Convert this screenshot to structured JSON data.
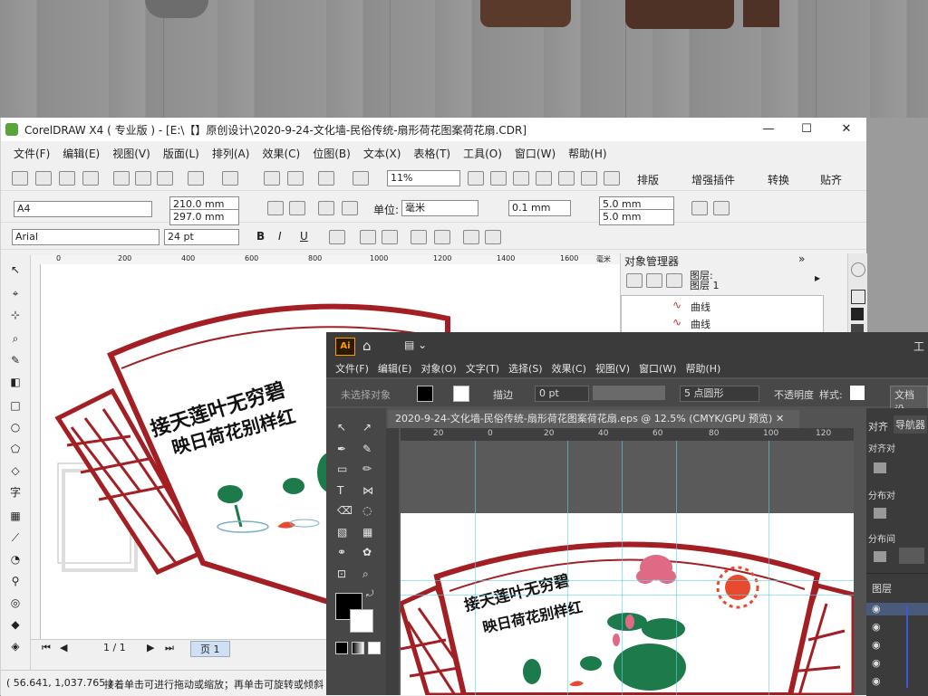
{
  "corel": {
    "title": "CorelDRAW X4 ( 专业版 ) - [E:\\【】原创设计\\2020-9-24-文化墙-民俗传统-扇形荷花图案荷花扇.CDR]",
    "menu": [
      "文件(F)",
      "编辑(E)",
      "视图(V)",
      "版面(L)",
      "排列(A)",
      "效果(C)",
      "位图(B)",
      "文本(X)",
      "表格(T)",
      "工具(O)",
      "窗口(W)",
      "帮助(H)"
    ],
    "zoom": "11%",
    "toolbar_right": [
      "排版",
      "增强插件",
      "转换",
      "贴齐"
    ],
    "paper": "A4",
    "width": "210.0 mm",
    "height": "297.0 mm",
    "units_label": "单位:",
    "units": "毫米",
    "nudge": "0.1 mm",
    "dup_x": "5.0 mm",
    "dup_y": "5.0 mm",
    "font": "Arial",
    "size": "24 pt",
    "ruler": [
      "200",
      "0",
      "200",
      "400",
      "600",
      "800",
      "1000",
      "1200",
      "1400",
      "1600",
      "毫米"
    ],
    "objmgr": {
      "title": "对象管理器",
      "layer_head": "图层:",
      "layer": "图层 1",
      "items": [
        "曲线",
        "曲线"
      ]
    },
    "page_nav": "1 / 1",
    "page_tab": "页 1",
    "status_coords": "( 56.641, 1,037.765 )",
    "status_text": "接着单击可进行拖动或缩放；再单击可旋转或倾斜"
  },
  "ai": {
    "logo": "Ai",
    "menu": [
      "文件(F)",
      "编辑(E)",
      "对象(O)",
      "文字(T)",
      "选择(S)",
      "效果(C)",
      "视图(V)",
      "窗口(W)",
      "帮助(H)"
    ],
    "no_selection": "未选择对象",
    "stroke_label": "描边",
    "stroke_value": "0 pt",
    "brush": "5 点圆形",
    "opacity": "不透明度",
    "style": "样式:",
    "doc_setup": "文档设",
    "tab": "2020-9-24-文化墙-民俗传统-扇形荷花图案荷花扇.eps @ 12.5% (CMYK/GPU 预览)",
    "ruler": [
      "20",
      "0",
      "20",
      "40",
      "60",
      "80",
      "100",
      "120"
    ],
    "panel_align": "对齐",
    "panel_nav": "导航器",
    "panel_layers": "图层",
    "panel_align2": "对齐对",
    "panel_dist": "分布对",
    "panel_dist2": "分布间"
  },
  "artwork": {
    "line1": "接天莲叶无穷碧",
    "line2": "映日荷花别样红"
  },
  "colors": {
    "frame_red": "#a31f24",
    "leaf_green": "#1d7a4a",
    "lotus_pink": "#e06a86",
    "sun_red": "#e84a2f"
  }
}
